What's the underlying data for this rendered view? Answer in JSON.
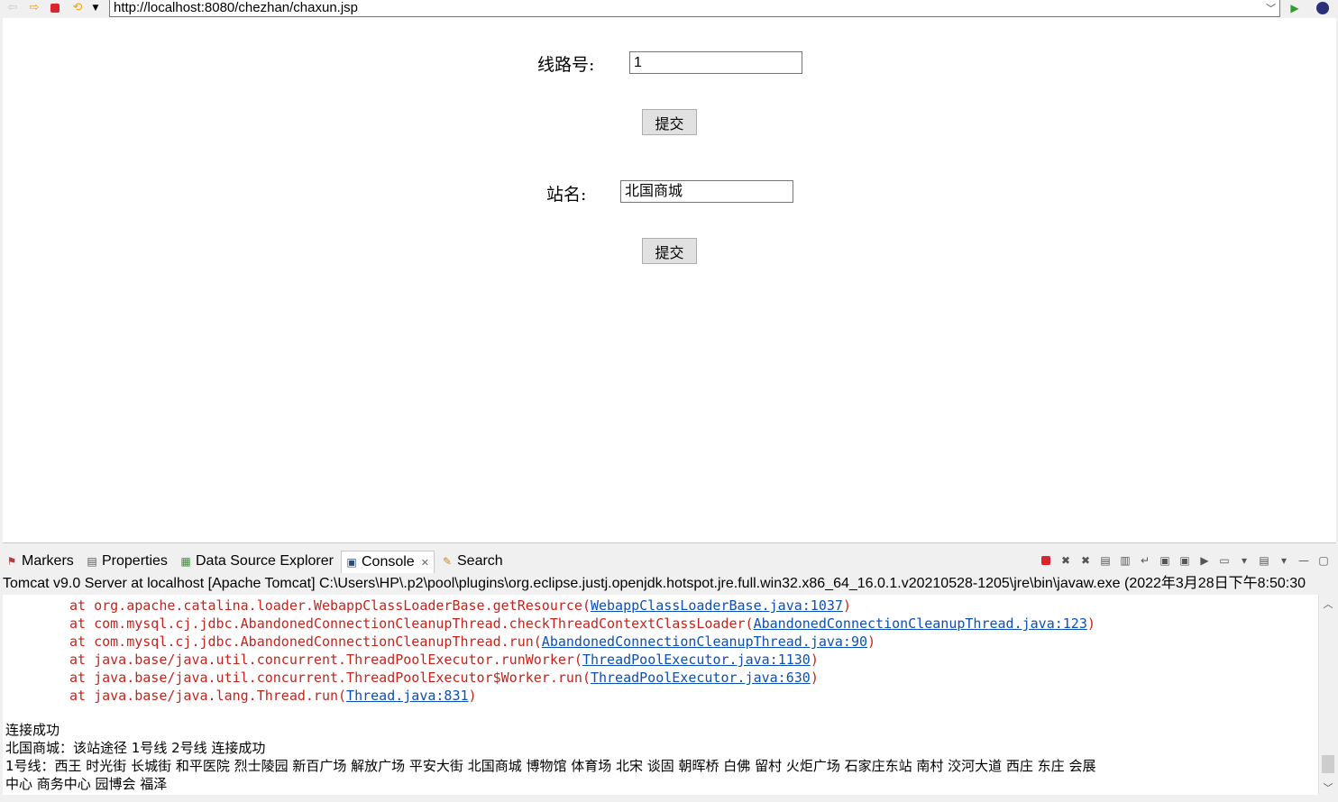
{
  "browser": {
    "url": "http://localhost:8080/chezhan/chaxun.jsp",
    "icons": [
      "back-arrow-icon",
      "forward-arrow-icon",
      "stop-icon",
      "refresh-icon",
      "dropdown-icon",
      "go-icon",
      "eclipse-icon"
    ]
  },
  "form": {
    "route_label": "线路号:",
    "route_value": "1",
    "submit1_label": "提交",
    "station_label": "站名:",
    "station_value": "北国商城",
    "submit2_label": "提交"
  },
  "views": {
    "tabs": [
      {
        "label": "Markers",
        "icon": "markers-icon"
      },
      {
        "label": "Properties",
        "icon": "properties-icon"
      },
      {
        "label": "Data Source Explorer",
        "icon": "datasource-icon"
      },
      {
        "label": "Console",
        "icon": "console-icon",
        "active": true
      },
      {
        "label": "Search",
        "icon": "search-icon"
      }
    ]
  },
  "console": {
    "header": "Tomcat v9.0 Server at localhost [Apache Tomcat] C:\\Users\\HP\\.p2\\pool\\plugins\\org.eclipse.justj.openjdk.hotspot.jre.full.win32.x86_64_16.0.1.v20210528-1205\\jre\\bin\\javaw.exe  (2022年3月28日下午8:50:30",
    "trace": [
      {
        "text": "at org.apache.catalina.loader.WebappClassLoaderBase.getResource(",
        "link": "WebappClassLoaderBase.java:1037",
        "end": ")"
      },
      {
        "text": "at com.mysql.cj.jdbc.AbandonedConnectionCleanupThread.checkThreadContextClassLoader(",
        "link": "AbandonedConnectionCleanupThread.java:123",
        "end": ")"
      },
      {
        "text": "at com.mysql.cj.jdbc.AbandonedConnectionCleanupThread.run(",
        "link": "AbandonedConnectionCleanupThread.java:90",
        "end": ")"
      },
      {
        "text": "at java.base/java.util.concurrent.ThreadPoolExecutor.runWorker(",
        "link": "ThreadPoolExecutor.java:1130",
        "end": ")"
      },
      {
        "text": "at java.base/java.util.concurrent.ThreadPoolExecutor$Worker.run(",
        "link": "ThreadPoolExecutor.java:630",
        "end": ")"
      },
      {
        "text": "at java.base/java.lang.Thread.run(",
        "link": "Thread.java:831",
        "end": ")"
      }
    ],
    "output": [
      "连接成功",
      "北国商城：该站途径 1号线 2号线 连接成功",
      "1号线：西王 时光街 长城街 和平医院 烈士陵园 新百广场 解放广场 平安大街 北国商城 博物馆 体育场 北宋 谈固 朝晖桥 白佛 留村 火炬广场 石家庄东站 南村 洨河大道 西庄 东庄 会展",
      "中心 商务中心 园博会 福泽"
    ]
  }
}
